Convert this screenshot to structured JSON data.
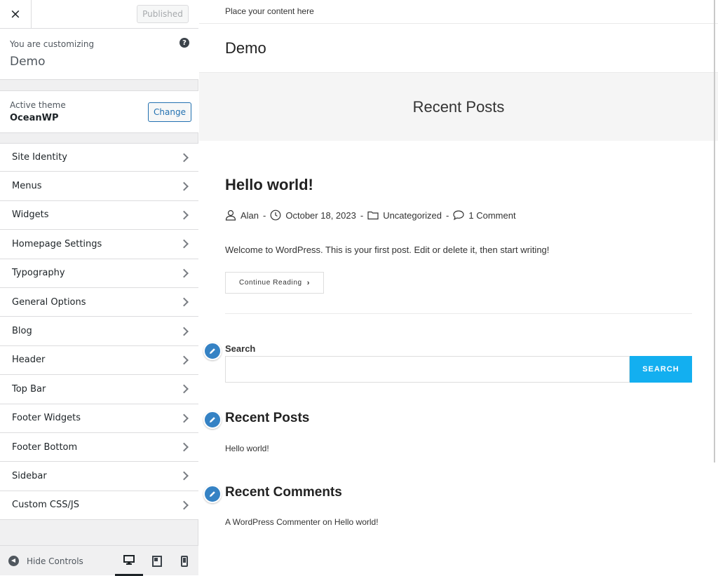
{
  "sidebar": {
    "close_label": "×",
    "publish_label": "Published",
    "customizing_label": "You are customizing",
    "site_name": "Demo",
    "help_label": "?",
    "active_theme_label": "Active theme",
    "theme_name": "OceanWP",
    "change_label": "Change",
    "panels": [
      "Site Identity",
      "Menus",
      "Widgets",
      "Homepage Settings",
      "Typography",
      "General Options",
      "Blog",
      "Header",
      "Top Bar",
      "Footer Widgets",
      "Footer Bottom",
      "Sidebar",
      "Custom CSS/JS"
    ],
    "hide_controls_label": "Hide Controls",
    "devices": [
      "desktop-icon",
      "tablet-icon",
      "mobile-icon"
    ],
    "active_device": "desktop"
  },
  "preview": {
    "topbar_text": "Place your content here",
    "site_title": "Demo",
    "page_title": "Recent Posts",
    "post": {
      "title": "Hello world!",
      "author": "Alan",
      "date": "October 18, 2023",
      "category": "Uncategorized",
      "comments": "1 Comment",
      "separator": "-",
      "excerpt": "Welcome to WordPress. This is your first post. Edit or delete it, then start writing!",
      "continue_label": "Continue Reading",
      "continue_arrow": "›"
    },
    "widgets": {
      "search_title": "Search",
      "search_placeholder": "",
      "search_button": "SEARCH",
      "recent_posts_title": "Recent Posts",
      "recent_posts_item": "Hello world!",
      "recent_comments_title": "Recent Comments",
      "recent_comment_author": "A WordPress Commenter",
      "recent_comment_on": "on",
      "recent_comment_post": "Hello world!"
    }
  },
  "colors": {
    "accent": "#2271b1",
    "search_button": "#13aff0",
    "edit_shortcut": "#3582c4",
    "sidebar_bg": "#f0f0f1"
  }
}
